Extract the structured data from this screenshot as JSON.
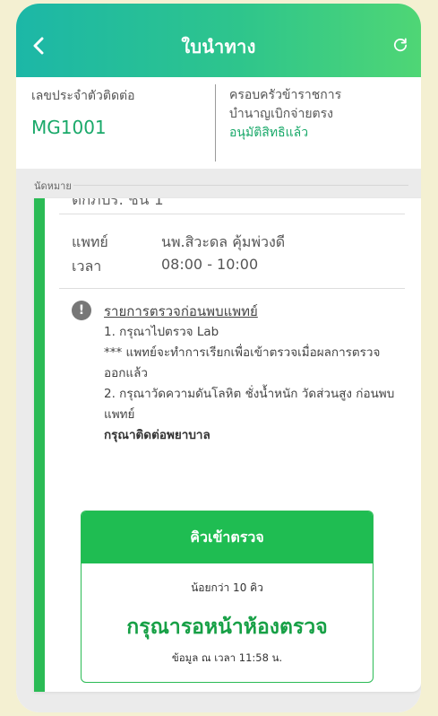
{
  "header": {
    "title": "ใบนำทาง"
  },
  "info": {
    "contact_id_label": "เลขประจำตัวติดต่อ",
    "contact_id": "MG1001",
    "family_line1": "ครอบครัวข้าราชการ",
    "family_line2": "บำนาญเบิกจ่ายตรง",
    "status": "อนุมัติสิทธิแล้ว"
  },
  "appointment": {
    "section_label": "นัดหมาย",
    "location": "ตึกภปร. ชั้น 1",
    "doctor_label": "แพทย์",
    "doctor_value": "นพ.สิวะดล คุ้มพ่วงดี",
    "time_label": "เวลา",
    "time_value": "08:00 - 10:00"
  },
  "preparation": {
    "title": "รายการตรวจก่อนพบแพทย์",
    "line1": "1. กรุณาไปตรวจ Lab",
    "line2": "*** แพทย์จะทำการเรียกเพื่อเข้าตรวจเมื่อผลการตรวจออกแล้ว",
    "line3": "2. กรุณาวัดความดันโลหิต ชั่งน้ำหนัก วัดส่วนสูง ก่อนพบแพทย์",
    "contact": "กรุณาติดต่อพยาบาล"
  },
  "queue": {
    "header": "คิวเข้าตรวจ",
    "count_text": "น้อยกว่า 10 คิว",
    "message": "กรุณารอหน้าห้องตรวจ",
    "updated_text": "ข้อมูล ณ เวลา 11:58 น."
  },
  "colors": {
    "header_start": "#1cb7a7",
    "header_end": "#4fd675",
    "accent_green": "#2bbb55",
    "code_green": "#1aa96a"
  },
  "icons": {
    "back": "chevron-left-icon",
    "refresh": "refresh-icon",
    "alert": "exclamation-circle-icon"
  }
}
